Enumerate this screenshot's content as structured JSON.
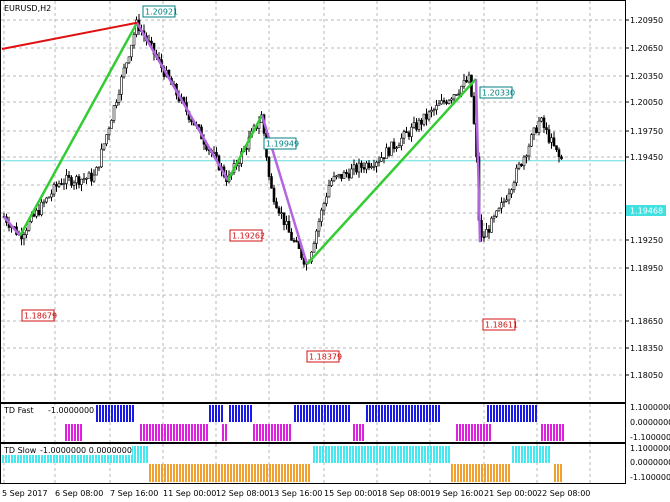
{
  "symbol_title": "EURUSD,H2",
  "colors": {
    "grid": "#b8b8b8",
    "candle": "#000000",
    "zz_up": "#33cc33",
    "zz_down": "#b266e0",
    "trend": "#e01010",
    "bid_line": "#66dddd",
    "bid_tag_bg": "#40e0e0",
    "blue_bars": "#1a1ae6",
    "magenta_bars": "#e020e0",
    "cyan_bars": "#44e8f0",
    "orange_bars": "#f0a030",
    "high_tag": "#008080",
    "low_tag": "#d01010"
  },
  "price_axis": {
    "ticks": [
      "1.20950",
      "1.20650",
      "1.20350",
      "1.20050",
      "1.19750",
      "1.19450",
      "1.19250",
      "1.18950",
      "1.18650",
      "1.18350",
      "1.18050"
    ],
    "current_price": "1.19468"
  },
  "time_axis": {
    "ticks": [
      "5 Sep 2017",
      "6 Sep 08:00",
      "7 Sep 16:00",
      "11 Sep 00:00",
      "12 Sep 08:00",
      "13 Sep 16:00",
      "15 Sep 00:00",
      "18 Sep 08:00",
      "19 Sep 16:00",
      "21 Sep 00:00",
      "22 Sep 08:00"
    ]
  },
  "zigzag_labels": {
    "h1": "1.20921",
    "l1": "1.18679",
    "l2": "1.19262",
    "h2": "1.19949",
    "l3": "1.18379",
    "h3": "1.20330",
    "l4": "1.18611"
  },
  "td_fast": {
    "label": "TD Fast",
    "value": "-1.0000000",
    "axis": [
      "1.1000000",
      "0.0000000",
      "-1.1000000"
    ]
  },
  "td_slow": {
    "label": "TD Slow",
    "value": "-1.0000000 0.0000000",
    "axis": [
      "1.1000000",
      "0.0000000",
      "-1.1000000"
    ]
  }
}
